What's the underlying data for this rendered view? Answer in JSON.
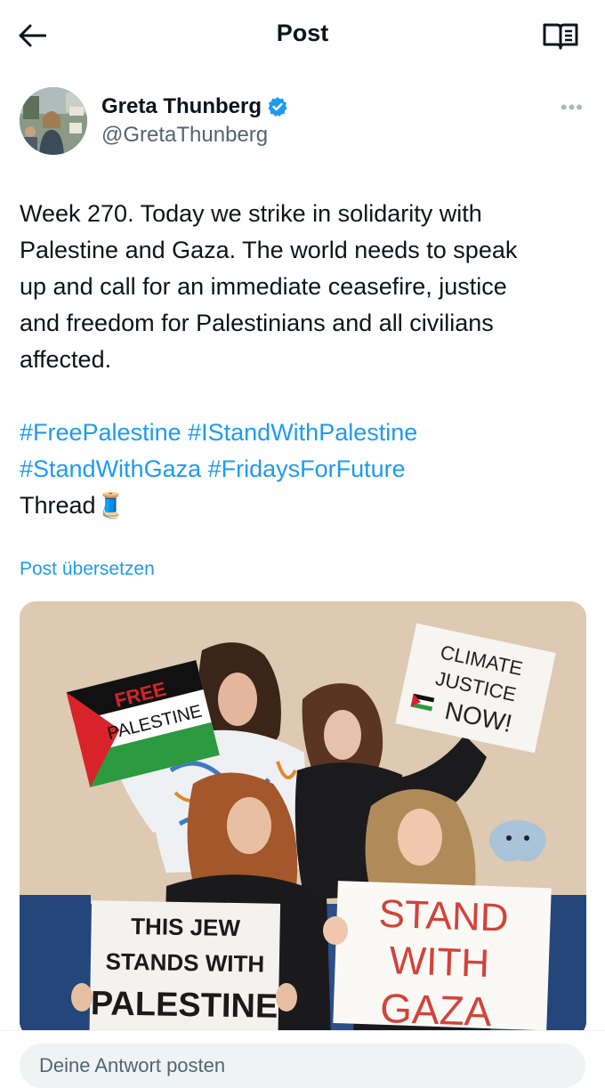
{
  "header": {
    "title": "Post",
    "back_icon": "arrow-left-icon",
    "reader_icon": "book-open-icon"
  },
  "author": {
    "display_name": "Greta Thunberg",
    "handle": "@GretaThunberg",
    "verified_icon": "verified-badge-icon",
    "verified_color": "#1d9bf0",
    "more_label": "•••"
  },
  "tweet": {
    "text_lines": [
      "Week 270. Today we strike in solidarity with",
      "Palestine and Gaza. The world needs to speak",
      "up and call for an immediate ceasefire, justice",
      "and freedom for Palestinians and all civilians",
      "affected."
    ],
    "hashtags_line1": [
      "#FreePalestine",
      "#IStandWithPalestine"
    ],
    "hashtags_line2": [
      "#StandWithGaza",
      "#FridaysForFuture"
    ],
    "thread_label": "Thread",
    "thread_emoji": "🧵",
    "hashtag_color": "#1d9bf0"
  },
  "translate_label": "Post übersetzen",
  "photo": {
    "signs": {
      "free_palestine": [
        "FREE",
        "PALESTINE"
      ],
      "climate_justice": [
        "CLIMATE",
        "JUSTICE",
        "NOW!"
      ],
      "this_jew": [
        "THIS JEW",
        "STANDS WITH",
        "PALESTINE"
      ],
      "stand_with_gaza": [
        "STAND",
        "WITH",
        "GAZA"
      ]
    }
  },
  "reply": {
    "placeholder": "Deine Antwort posten"
  }
}
